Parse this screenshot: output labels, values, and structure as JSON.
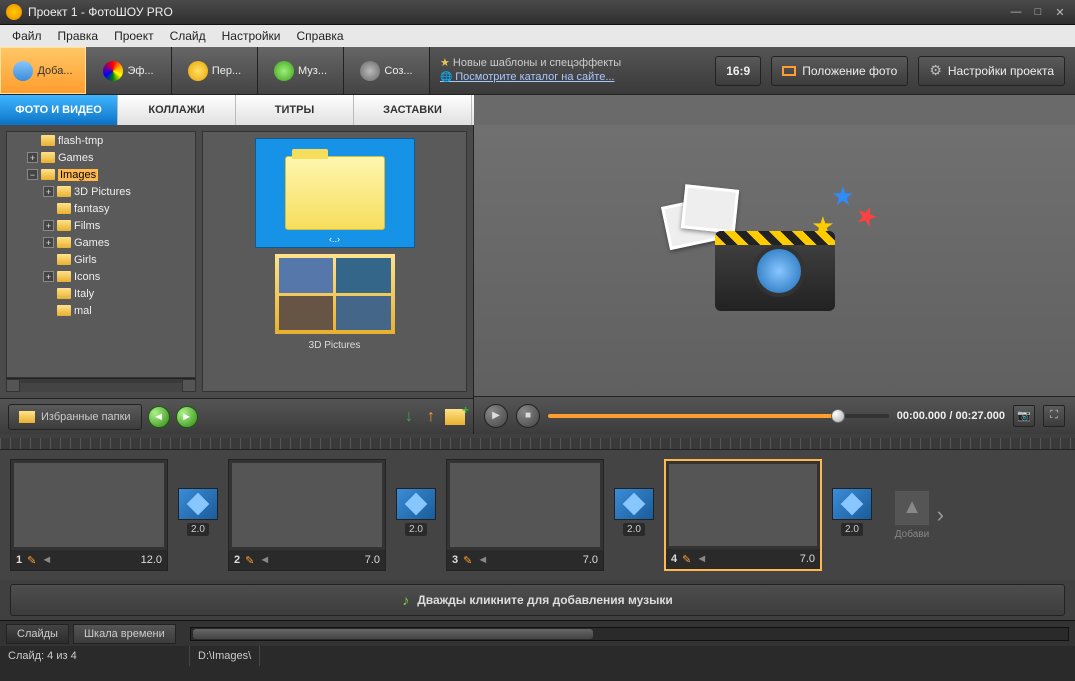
{
  "title": "Проект 1 - ФотоШОУ PRO",
  "menu": [
    "Файл",
    "Правка",
    "Проект",
    "Слайд",
    "Настройки",
    "Справка"
  ],
  "mainTabs": [
    {
      "label": "Доба...",
      "icon": "ic-cam"
    },
    {
      "label": "Эф...",
      "icon": "ic-pal"
    },
    {
      "label": "Пер...",
      "icon": "ic-star"
    },
    {
      "label": "Муз...",
      "icon": "ic-note"
    },
    {
      "label": "Соз...",
      "icon": "ic-reel"
    }
  ],
  "tips": {
    "t1": "Новые шаблоны и спецэффекты",
    "t2": "Посмотрите каталог на сайте..."
  },
  "buttons": {
    "aspect": "16:9",
    "pos": "Положение фото",
    "settings": "Настройки проекта"
  },
  "subTabs": [
    "ФОТО И ВИДЕО",
    "КОЛЛАЖИ",
    "ТИТРЫ",
    "ЗАСТАВКИ"
  ],
  "tree": [
    {
      "indent": 1,
      "exp": "",
      "label": "flash-tmp"
    },
    {
      "indent": 1,
      "exp": "+",
      "label": "Games"
    },
    {
      "indent": 1,
      "exp": "−",
      "label": "Images",
      "sel": true
    },
    {
      "indent": 2,
      "exp": "+",
      "label": "3D Pictures"
    },
    {
      "indent": 2,
      "exp": "",
      "label": "fantasy"
    },
    {
      "indent": 2,
      "exp": "+",
      "label": "Films"
    },
    {
      "indent": 2,
      "exp": "+",
      "label": "Games"
    },
    {
      "indent": 2,
      "exp": "",
      "label": "Girls"
    },
    {
      "indent": 2,
      "exp": "+",
      "label": "Icons"
    },
    {
      "indent": 2,
      "exp": "",
      "label": "Italy"
    },
    {
      "indent": 2,
      "exp": "",
      "label": "mal"
    }
  ],
  "thumbNav": "‹..›",
  "thumb2Label": "3D Pictures",
  "fav": "Избранные папки",
  "playback": {
    "time": "00:00.000 / 00:27.000"
  },
  "slides": [
    {
      "num": "1",
      "dur": "12.0",
      "img": "s-img1"
    },
    {
      "num": "2",
      "dur": "7.0",
      "img": "s-img2"
    },
    {
      "num": "3",
      "dur": "7.0",
      "img": "s-img3"
    },
    {
      "num": "4",
      "dur": "7.0",
      "img": "s-img4",
      "sel": true
    }
  ],
  "transDur": "2.0",
  "addSlide": "Добави",
  "music": "Дважды кликните для добавления музыки",
  "bottomTabs": [
    "Слайды",
    "Шкала времени"
  ],
  "status": {
    "slide": "Слайд: 4 из 4",
    "path": "D:\\Images\\"
  }
}
